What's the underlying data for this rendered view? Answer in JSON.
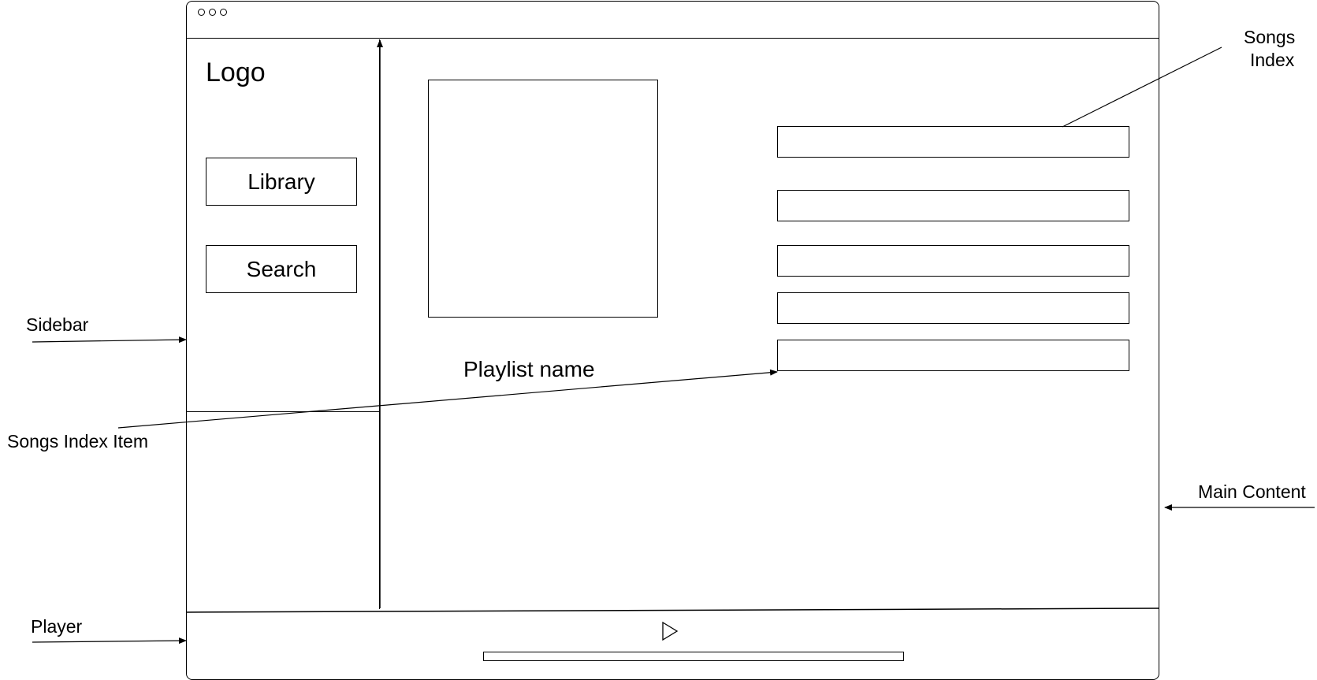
{
  "app": {
    "logo": "Logo",
    "nav": {
      "library_label": "Library",
      "search_label": "Search"
    },
    "main": {
      "playlist_name": "Playlist name",
      "songs": [
        {
          "label": ""
        },
        {
          "label": ""
        },
        {
          "label": ""
        },
        {
          "label": ""
        },
        {
          "label": ""
        }
      ]
    },
    "player": {
      "play_icon": "play-icon"
    }
  },
  "annotations": {
    "sidebar": "Sidebar",
    "songs_index_item": "Songs Index Item",
    "player": "Player",
    "songs_index_line1": "Songs",
    "songs_index_line2": "Index",
    "main_content": "Main Content"
  }
}
